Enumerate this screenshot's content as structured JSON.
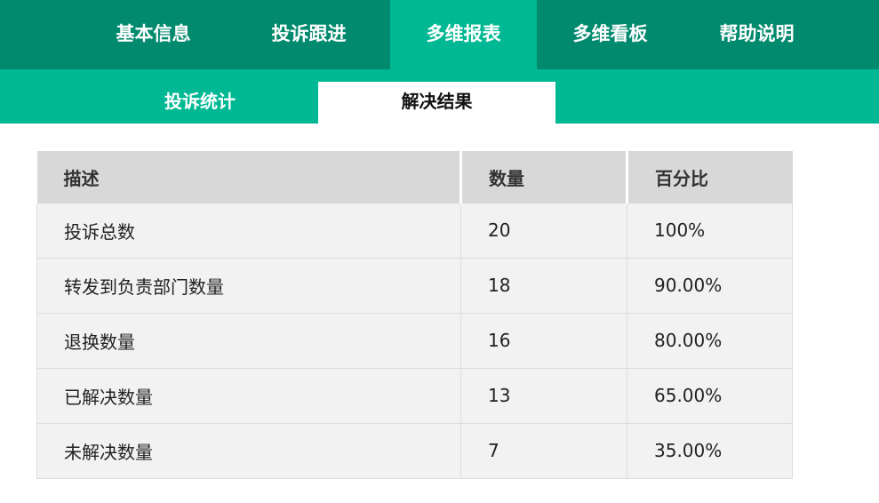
{
  "top_nav": {
    "tabs": [
      {
        "label": "基本信息",
        "active": false
      },
      {
        "label": "投诉跟进",
        "active": false
      },
      {
        "label": "多维报表",
        "active": true
      },
      {
        "label": "多维看板",
        "active": false
      },
      {
        "label": "帮助说明",
        "active": false
      }
    ]
  },
  "sub_nav": {
    "tabs": [
      {
        "label": "投诉统计",
        "active": false
      },
      {
        "label": "解决结果",
        "active": true
      }
    ]
  },
  "table": {
    "headers": [
      "描述",
      "数量",
      "百分比"
    ],
    "rows": [
      [
        "投诉总数",
        "20",
        "100%"
      ],
      [
        "转发到负责部门数量",
        "18",
        "90.00%"
      ],
      [
        "退换数量",
        "16",
        "80.00%"
      ],
      [
        "已解决数量",
        "13",
        "65.00%"
      ],
      [
        "未解决数量",
        "7",
        "35.00%"
      ]
    ]
  },
  "colors": {
    "top_nav_bg": "#018a6d",
    "accent": "#00b893",
    "header_bg": "#d8d8d8",
    "row_bg": "#f2f2f2"
  }
}
